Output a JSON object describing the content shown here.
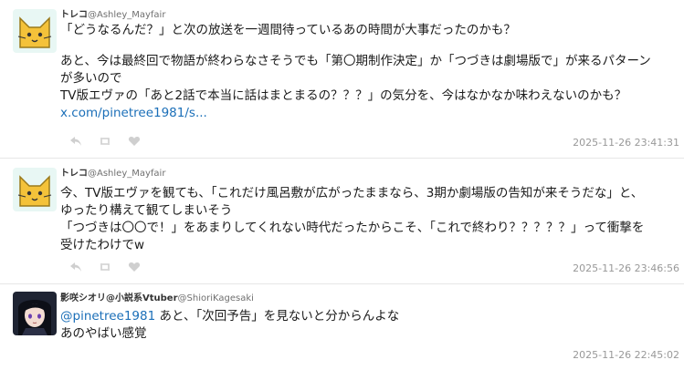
{
  "tweets": [
    {
      "author_name": "トレコ",
      "handle": "@Ashley_Mayfair",
      "avatar_icon": "cat-face-icon",
      "lines": [
        "「どうなるんだ？」と次の放送を一週間待っているあの時間が大事だったのかも？",
        "あと、今は最終回で物語が終わらなさそうでも「第〇期制作決定」か「つづきは劇場版で」が来るパターンが多いので",
        "TV版エヴァの「あと2話で本当に話はまとまるの？？？」の気分を、今はなかなか味わえないのかも？"
      ],
      "line_wrap": [
        "「どうなるんだ？」と次の放送を一週間待っているあの時間が大事だったのかも？",
        "",
        "あと、今は最終回で物語が終わらなさそうでも「第〇期制作決定」か「つづきは劇場版で」が来るパターン",
        "が多いので",
        "TV版エヴァの「あと2話で本当に話はまとまるの？？？」の気分を、今はなかなか味わえないのかも？"
      ],
      "link": "x.com/pinetree1981/s...",
      "timestamp": "2025-11-26 23:41:31"
    },
    {
      "author_name": "トレコ",
      "handle": "@Ashley_Mayfair",
      "avatar_icon": "cat-face-icon",
      "line_wrap": [
        "今、TV版エヴァを観ても、「これだけ風呂敷が広がったままなら、3期か劇場版の告知が来そうだな」と、",
        "ゆったり構えて観てしまいそう",
        "「つづきは〇〇で！」をあまりしてくれない時代だったからこそ、「これで終わり？？？？？」って衝撃を",
        "受けたわけでw"
      ],
      "timestamp": "2025-11-26 23:46:56"
    },
    {
      "author_name": "影咲シオリ@小説系Vtuber",
      "handle": "@ShioriKagesaki",
      "avatar_icon": "anime-girl-avatar-icon",
      "mention": "@pinetree1981",
      "line_wrap": [
        " あと、「次回予告」を見ないと分からんよな",
        "あのやばい感覚"
      ],
      "timestamp": "2025-11-26 22:45:02"
    }
  ],
  "action_icons": [
    "reply-icon",
    "retweet-icon",
    "like-icon"
  ],
  "colors": {
    "link": "#1b6fb8",
    "timestamp": "#999999",
    "icon": "#cfcfcf",
    "cat_bg": "#e8f7f4",
    "cat_face": "#f4c23a"
  }
}
